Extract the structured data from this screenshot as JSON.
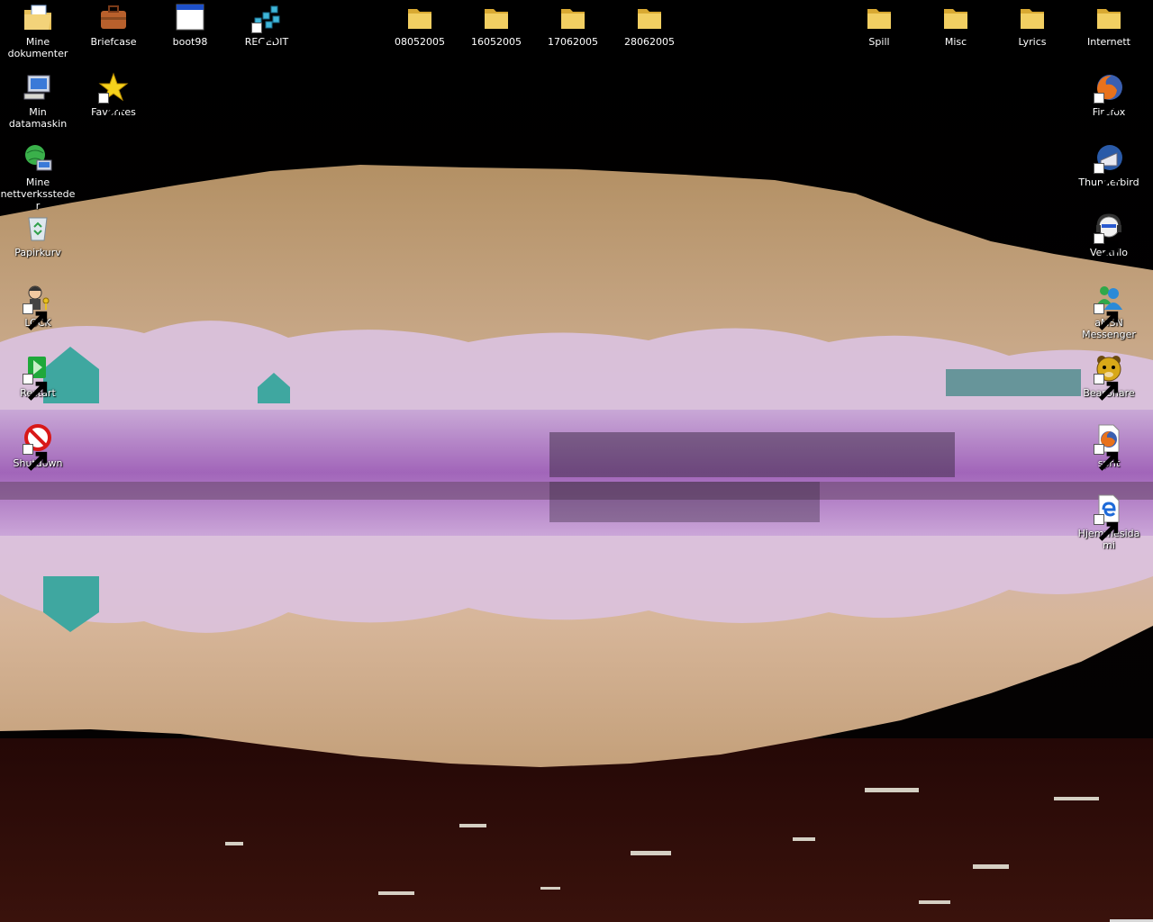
{
  "desktop": {
    "icons": [
      {
        "key": "mine-dokumenter",
        "label": "Mine dokumenter",
        "type": "mydocs",
        "shortcut": false
      },
      {
        "key": "briefcase",
        "label": "Briefcase",
        "type": "briefcase",
        "shortcut": false
      },
      {
        "key": "boot98",
        "label": "boot98",
        "type": "window",
        "shortcut": false
      },
      {
        "key": "regedit",
        "label": "REGEDIT",
        "type": "regedit",
        "shortcut": true
      },
      {
        "key": "folder-08052005",
        "label": "08052005",
        "type": "folder",
        "shortcut": false
      },
      {
        "key": "folder-16052005",
        "label": "16052005",
        "type": "folder",
        "shortcut": false
      },
      {
        "key": "folder-17062005",
        "label": "17062005",
        "type": "folder",
        "shortcut": false
      },
      {
        "key": "folder-28062005",
        "label": "28062005",
        "type": "folder",
        "shortcut": false
      },
      {
        "key": "folder-spill",
        "label": "Spill",
        "type": "folder",
        "shortcut": false
      },
      {
        "key": "folder-misc",
        "label": "Misc",
        "type": "folder",
        "shortcut": false
      },
      {
        "key": "folder-lyrics",
        "label": "Lyrics",
        "type": "folder",
        "shortcut": false
      },
      {
        "key": "folder-internett",
        "label": "Internett",
        "type": "folder",
        "shortcut": false
      },
      {
        "key": "min-datamaskin",
        "label": "Min datamaskin",
        "type": "computer",
        "shortcut": false
      },
      {
        "key": "favorites",
        "label": "Favorites",
        "type": "star",
        "shortcut": true
      },
      {
        "key": "firefox",
        "label": "Firefox",
        "type": "firefox",
        "shortcut": true
      },
      {
        "key": "mine-nettverkssteder",
        "label": "Mine nettverkssteder",
        "type": "network",
        "shortcut": false
      },
      {
        "key": "thunderbird",
        "label": "Thunderbird",
        "type": "thunderbird",
        "shortcut": true
      },
      {
        "key": "papirkurv",
        "label": "Papirkurv",
        "type": "recycle",
        "shortcut": false
      },
      {
        "key": "ventrilo",
        "label": "Ventrilo",
        "type": "ventrilo",
        "shortcut": true
      },
      {
        "key": "lock",
        "label": "LOCK",
        "type": "lock",
        "shortcut": true
      },
      {
        "key": "amsn",
        "label": "aMSN Messenger",
        "type": "msn",
        "shortcut": true
      },
      {
        "key": "restart",
        "label": "Restart",
        "type": "restart",
        "shortcut": true
      },
      {
        "key": "bearshare",
        "label": "BearShare",
        "type": "bearshare",
        "shortcut": true
      },
      {
        "key": "shutdown",
        "label": "Shutdown",
        "type": "shutdown",
        "shortcut": true
      },
      {
        "key": "sprit",
        "label": "sprit",
        "type": "firefoxdoc",
        "shortcut": true
      },
      {
        "key": "hjemmesida",
        "label": "Hjemmesida mi",
        "type": "iedoc",
        "shortcut": true
      }
    ]
  }
}
